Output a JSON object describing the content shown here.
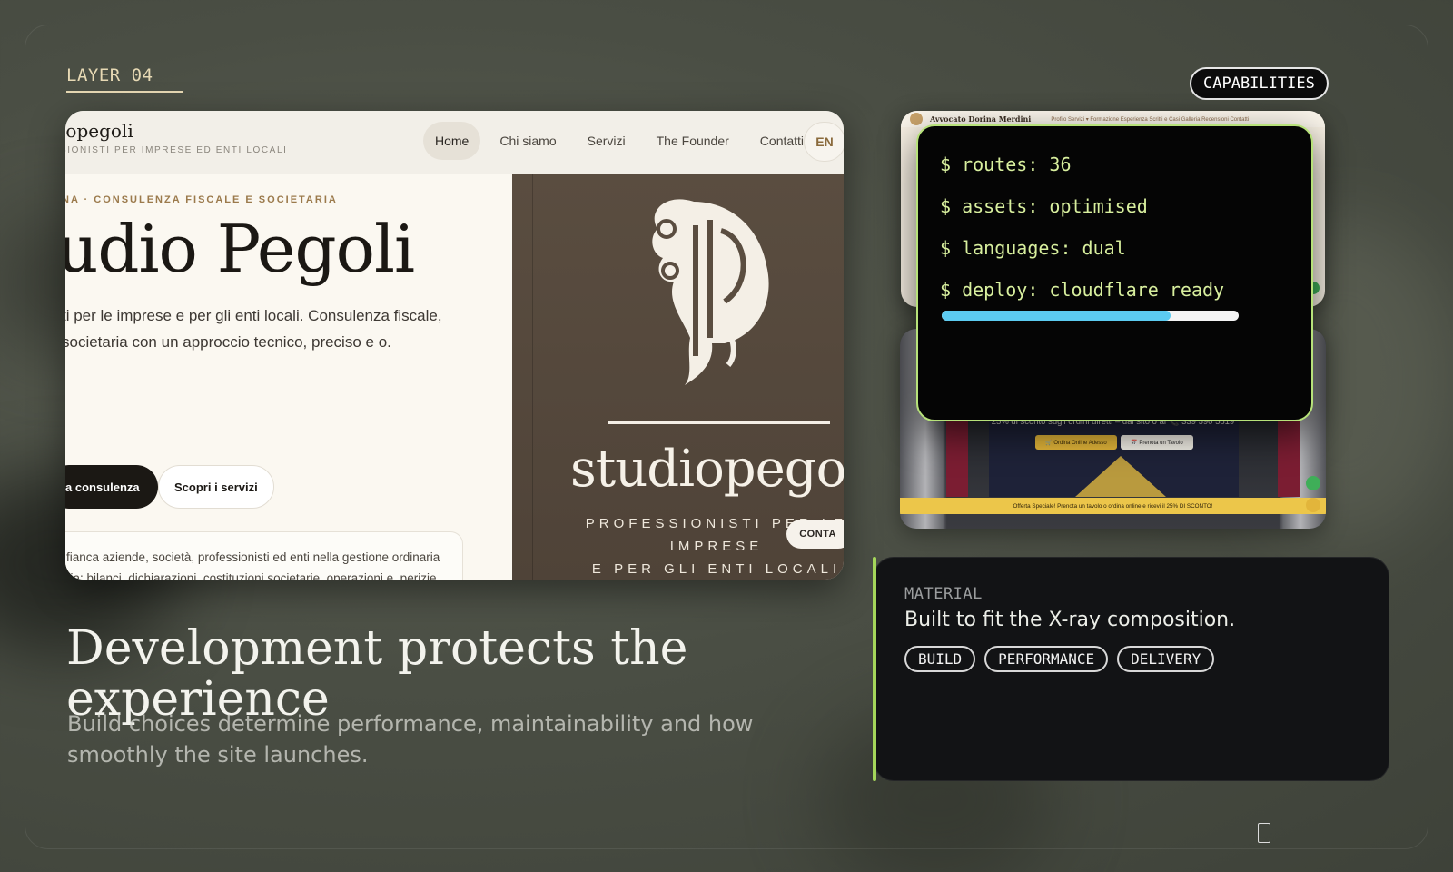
{
  "layer_label": "LAYER 04",
  "capabilities_badge": "CAPABILITIES",
  "preview": {
    "brand_name": "iopegoli",
    "brand_sub": "SIONISTI PER IMPRESE ED ENTI LOCALI",
    "nav": [
      "Home",
      "Chi siamo",
      "Servizi",
      "The Founder",
      "Contatti"
    ],
    "lang": "EN",
    "kicker": "NA · CONSULENZA FISCALE E SOCIETARIA",
    "hero_title": "udio Pegoli",
    "hero_desc": "ti per le imprese e per gli enti locali. Consulenza fiscale, societaria con un approccio tecnico, preciso e o.",
    "btn_primary": "a consulenza",
    "btn_secondary": "Scopri i servizi",
    "info_text": "fianca aziende, società, professionisti ed enti nella gestione ordinaria ria: bilanci, dichiarazioni, costituzioni societarie, operazioni e, perizie e contenzioso tributario.",
    "logo_word": "studiopegol",
    "logo_tag_1": "PROFESSIONISTI PER LE",
    "logo_tag_2": "IMPRESE",
    "logo_tag_3": "E PER GLI ENTI LOCALI",
    "contact_pill": "CONTA"
  },
  "thumb1": {
    "name": "Avvocato Dorina Merdini",
    "links": "Profilo  Servizi ▾  Formazione  Esperienza  Scritti e Casi  Galleria  Recensioni  Contatti"
  },
  "thumb2": {
    "promo": "25% di sconto sugli ordini diretti – dal sito o al 📞 339 590 5819",
    "btn_order": "🛒 Ordina Online Adesso",
    "btn_table": "📅 Prenota un Tavolo",
    "banner": "Offerta Speciale! Prenota un tavolo o ordina online e ricevi il 25% DI SCONTO!"
  },
  "terminal": {
    "lines": [
      "$ routes: 36",
      "$ assets: optimised",
      "$ languages: dual",
      "$ deploy: cloudflare ready"
    ],
    "progress": 0.77
  },
  "material": {
    "label": "MATERIAL",
    "title": "Built to fit the X-ray composition.",
    "tags": [
      "BUILD",
      "PERFORMANCE",
      "DELIVERY"
    ]
  },
  "headline": "Development protects the experience",
  "subline": "Build choices determine performance, maintainability and how smoothly the site launches.",
  "colors": {
    "accent_green": "#a4d65a",
    "terminal_text": "#d8ef9e",
    "progress_fill": "#5ccbf1",
    "label_gold": "#e7d9b4"
  }
}
